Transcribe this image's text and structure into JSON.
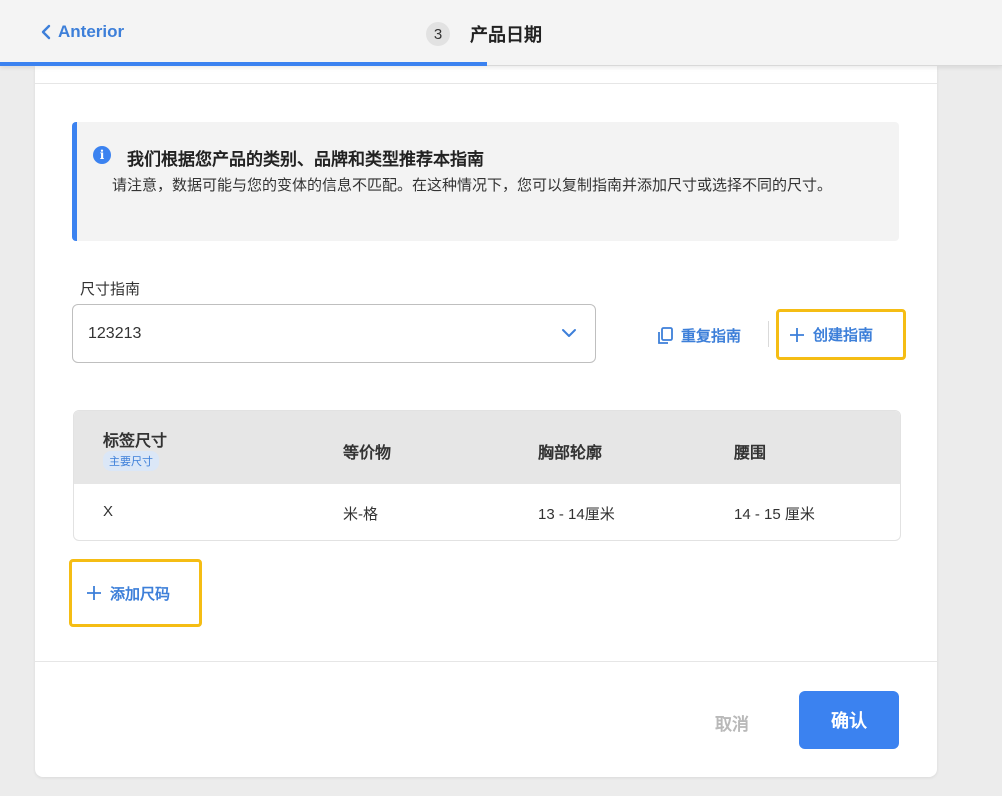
{
  "header": {
    "back_label": "Anterior",
    "step_number": "3",
    "step_title": "产品日期",
    "progress_fraction": 0.486
  },
  "info": {
    "title": "我们根据您产品的类别、品牌和类型推荐本指南",
    "body": "请注意，数据可能与您的变体的信息不匹配。在这种情况下，您可以复制指南并添加尺寸或选择不同的尺寸。"
  },
  "size_guide": {
    "label": "尺寸指南",
    "selected_value": "123213",
    "duplicate_label": "重复指南",
    "create_label": "创建指南"
  },
  "table": {
    "headers": [
      "标签尺寸",
      "等价物",
      "胸部轮廓",
      "腰围"
    ],
    "primary_badge": "主要尺寸",
    "rows": [
      [
        "X",
        "米-格",
        "13 - 14厘米",
        "14 - 15 厘米"
      ]
    ]
  },
  "add_size_label": "添加尺码",
  "footer": {
    "cancel_label": "取消",
    "confirm_label": "确认"
  },
  "colors": {
    "accent": "#3b82f0",
    "link": "#3d7fd9",
    "highlight": "#f5bd14"
  }
}
